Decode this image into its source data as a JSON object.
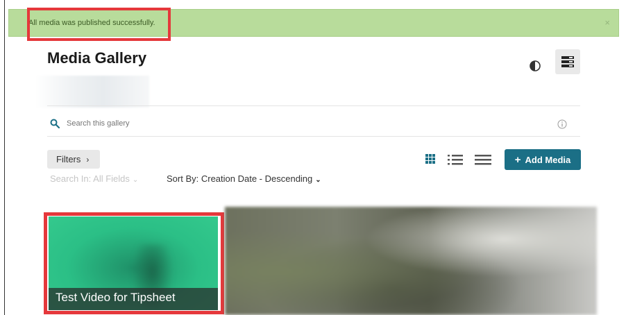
{
  "alert": {
    "message": "All media was published successfully.",
    "close_label": "×"
  },
  "header": {
    "title": "Media Gallery"
  },
  "search": {
    "placeholder": "Search this gallery"
  },
  "toolbar": {
    "filters_label": "Filters",
    "filters_chevron": "›",
    "add_media_label": "Add Media",
    "add_media_icon": "+",
    "search_in_label": "Search In: All Fields",
    "sort_by_label": "Sort By: Creation Date - Descending"
  },
  "media": [
    {
      "title": "Test Video for Tipsheet"
    }
  ],
  "colors": {
    "alert_bg": "#b8dc9b",
    "primary": "#1b6f86",
    "highlight": "#e5383b"
  },
  "icons": [
    "contrast-icon",
    "layout-toggle-icon",
    "search-icon",
    "info-icon",
    "grid-view-icon",
    "list-view-icon",
    "compact-view-icon"
  ]
}
